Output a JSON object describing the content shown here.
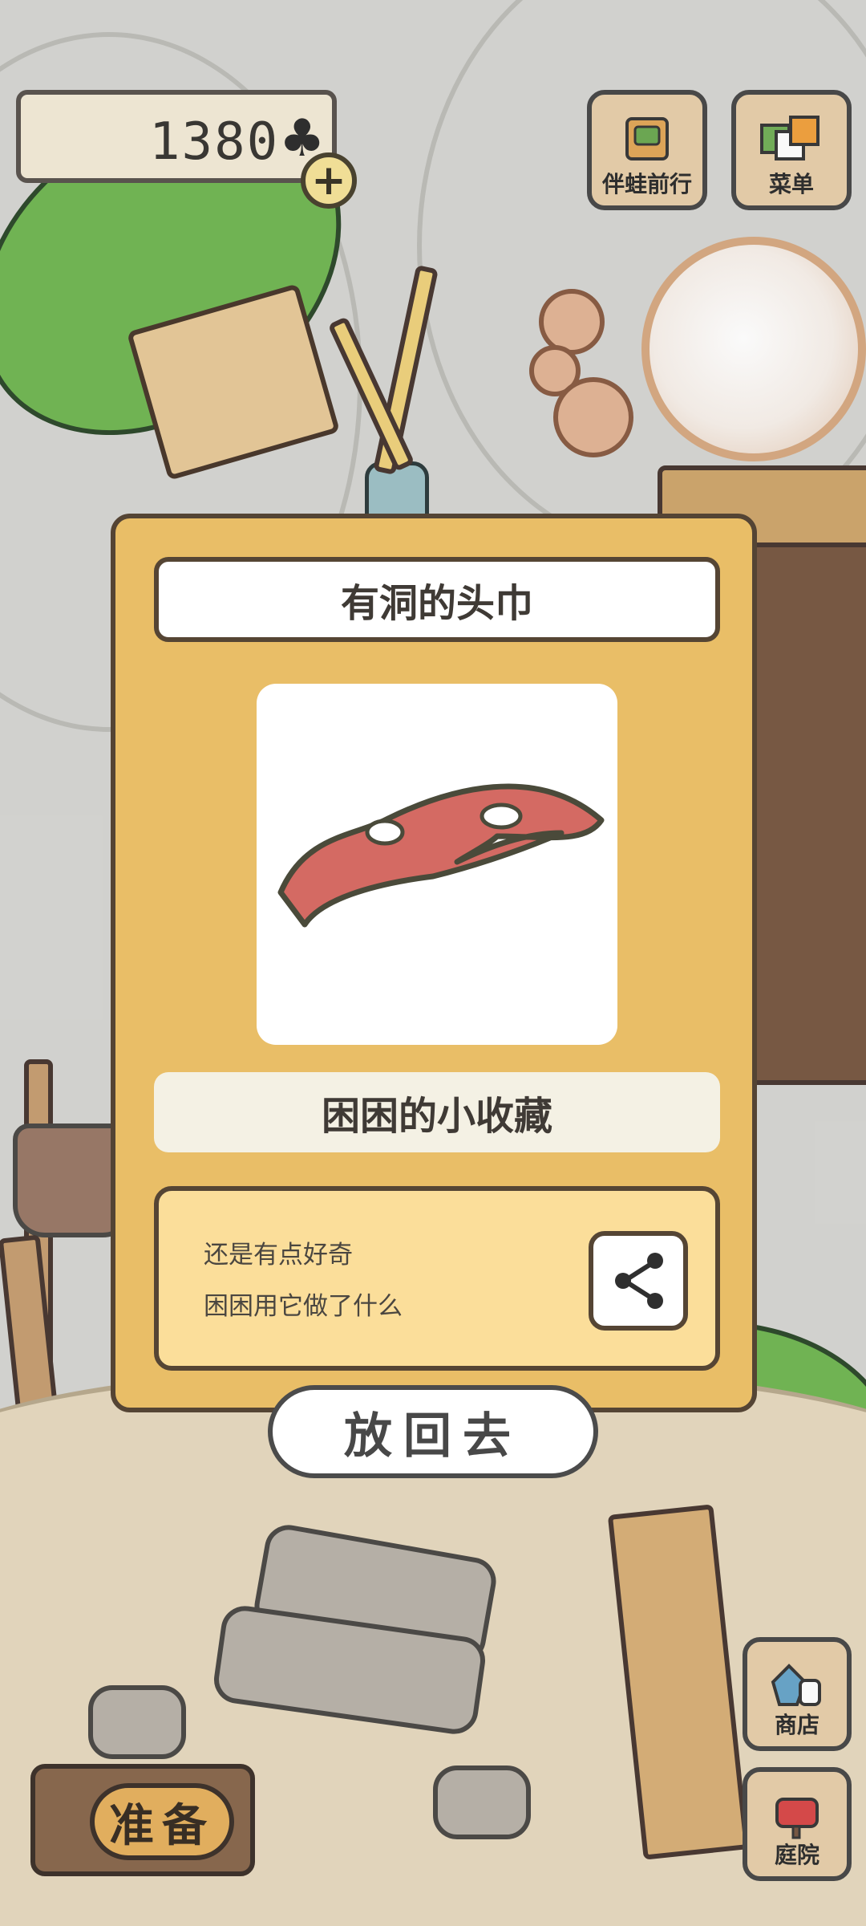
{
  "hud": {
    "coin_amount": "1380",
    "clover_icon": "♣",
    "plus_icon": "+",
    "travel_button": {
      "label": "伴蛙前行",
      "icon": "passport-icon"
    },
    "menu_button": {
      "label": "菜单",
      "icon": "menu-cards-icon"
    },
    "shop_button": {
      "label": "商店",
      "icon": "shop-bags-icon"
    },
    "garden_button": {
      "label": "庭院",
      "icon": "mailbox-icon"
    },
    "prepare_button": {
      "label": "准备"
    }
  },
  "modal": {
    "title": "有洞的头巾",
    "item_image": "red-bandana-with-holes-icon",
    "subtitle": "困困的小收藏",
    "description": [
      "还是有点好奇",
      "困困用它做了什么"
    ],
    "share_icon": "share-icon",
    "putback_label": "放回去"
  },
  "colors": {
    "modal_bg": "#e9be67",
    "panel_border": "#554534",
    "desc_bg": "#fbde9a",
    "item_red": "#d46a63"
  }
}
